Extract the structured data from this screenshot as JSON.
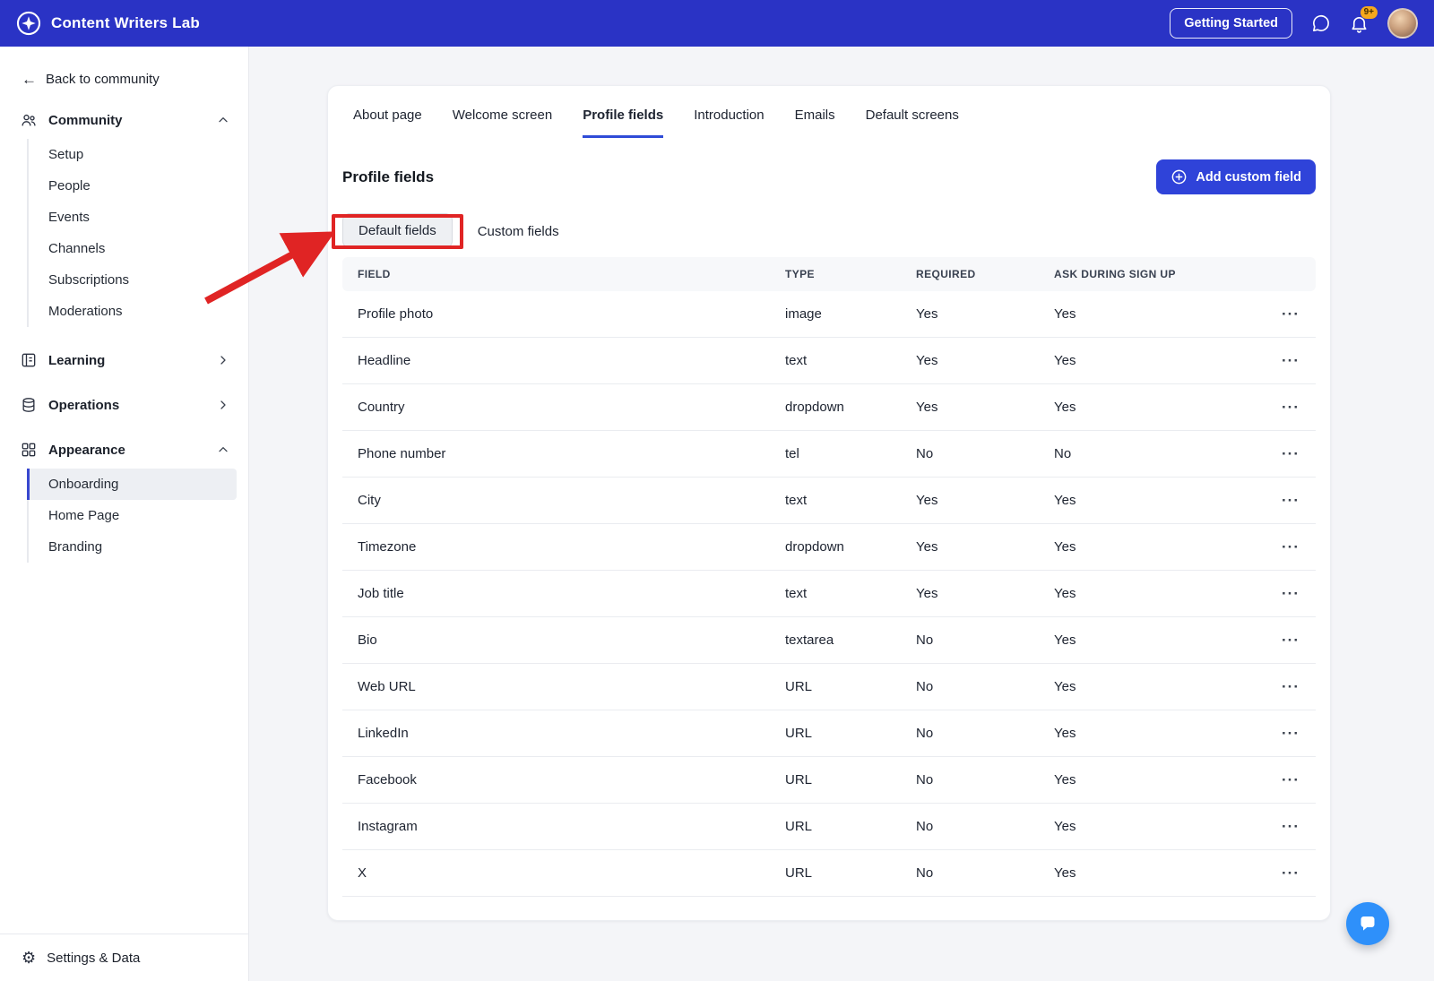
{
  "topbar": {
    "brand": "Content Writers Lab",
    "getting_started_label": "Getting Started",
    "notification_badge": "9+"
  },
  "sidebar": {
    "back_label": "Back to community",
    "sections": [
      {
        "label": "Community",
        "expanded": true,
        "items": [
          "Setup",
          "People",
          "Events",
          "Channels",
          "Subscriptions",
          "Moderations"
        ]
      },
      {
        "label": "Learning",
        "expanded": false,
        "items": []
      },
      {
        "label": "Operations",
        "expanded": false,
        "items": []
      },
      {
        "label": "Appearance",
        "expanded": true,
        "items": [
          "Onboarding",
          "Home Page",
          "Branding"
        ],
        "active_item": "Onboarding"
      }
    ],
    "footer_label": "Settings & Data"
  },
  "main": {
    "tabs": [
      {
        "label": "About page"
      },
      {
        "label": "Welcome screen"
      },
      {
        "label": "Profile fields",
        "active": true
      },
      {
        "label": "Introduction"
      },
      {
        "label": "Emails"
      },
      {
        "label": "Default screens"
      }
    ],
    "title": "Profile fields",
    "add_button_label": "Add custom field",
    "subtabs": [
      {
        "label": "Default fields",
        "active": true
      },
      {
        "label": "Custom fields"
      }
    ],
    "table": {
      "headers": [
        "FIELD",
        "TYPE",
        "REQUIRED",
        "ASK DURING SIGN UP"
      ],
      "rows": [
        {
          "field": "Profile photo",
          "type": "image",
          "required": "Yes",
          "ask": "Yes"
        },
        {
          "field": "Headline",
          "type": "text",
          "required": "Yes",
          "ask": "Yes"
        },
        {
          "field": "Country",
          "type": "dropdown",
          "required": "Yes",
          "ask": "Yes"
        },
        {
          "field": "Phone number",
          "type": "tel",
          "required": "No",
          "ask": "No"
        },
        {
          "field": "City",
          "type": "text",
          "required": "Yes",
          "ask": "Yes"
        },
        {
          "field": "Timezone",
          "type": "dropdown",
          "required": "Yes",
          "ask": "Yes"
        },
        {
          "field": "Job title",
          "type": "text",
          "required": "Yes",
          "ask": "Yes"
        },
        {
          "field": "Bio",
          "type": "textarea",
          "required": "No",
          "ask": "Yes"
        },
        {
          "field": "Web URL",
          "type": "URL",
          "required": "No",
          "ask": "Yes"
        },
        {
          "field": "LinkedIn",
          "type": "URL",
          "required": "No",
          "ask": "Yes"
        },
        {
          "field": "Facebook",
          "type": "URL",
          "required": "No",
          "ask": "Yes"
        },
        {
          "field": "Instagram",
          "type": "URL",
          "required": "No",
          "ask": "Yes"
        },
        {
          "field": "X",
          "type": "URL",
          "required": "No",
          "ask": "Yes"
        }
      ]
    }
  },
  "icons": {
    "ellipsis": "···",
    "back_arrow": "←",
    "gear": "⚙"
  },
  "colors": {
    "topbar": "#2a33c5",
    "accent": "#2f43d9",
    "annotation": "#e02424",
    "chat_fab": "#2e90fa"
  }
}
